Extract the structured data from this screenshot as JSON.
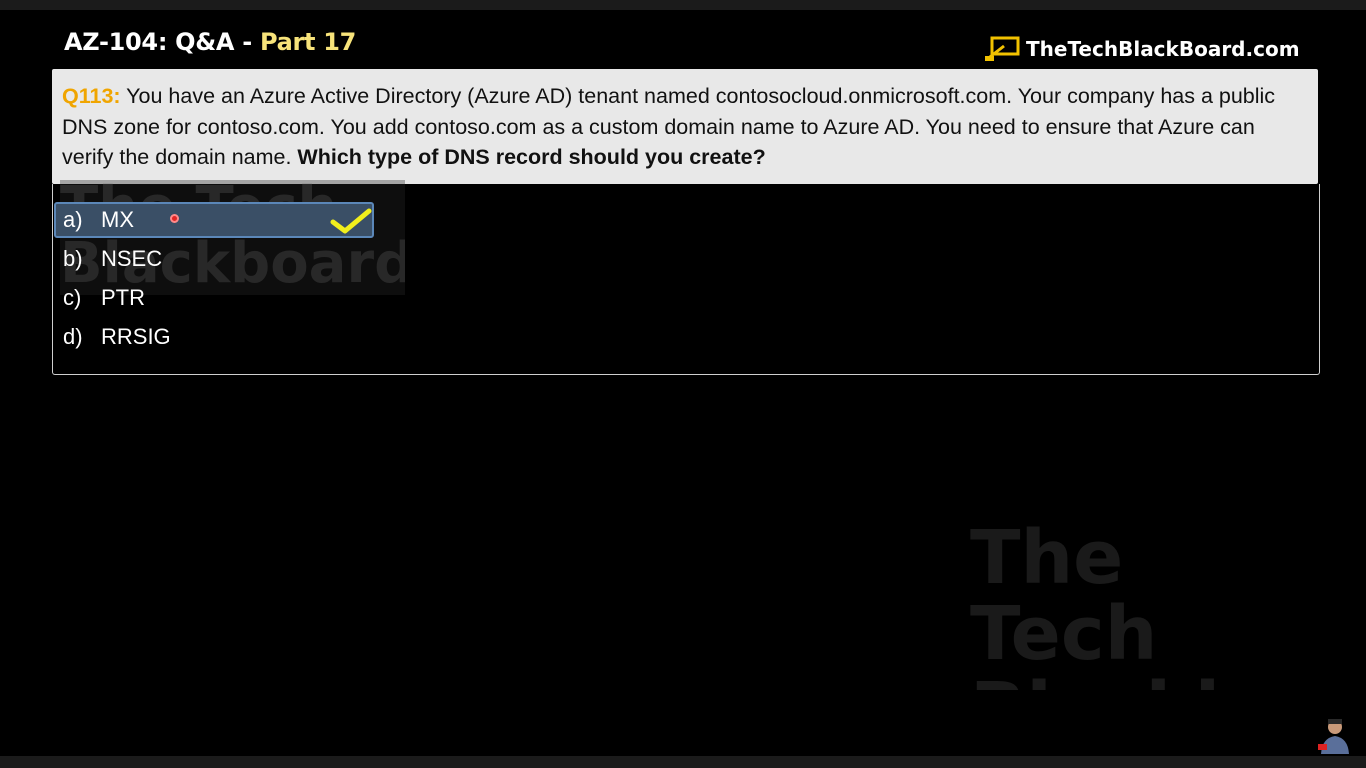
{
  "header": {
    "title_main": "AZ-104: Q&A - ",
    "title_part": "Part 17",
    "brand": "TheTechBlackBoard.com"
  },
  "question": {
    "number": "Q113:",
    "body": " You have an Azure Active Directory (Azure AD) tenant named contosocloud.onmicrosoft.com. Your company has a public DNS zone for contoso.com. You add contoso.com as a custom domain name to Azure AD. You need to ensure that Azure can verify the domain name. ",
    "ask": "Which type of DNS record should you create?"
  },
  "options": [
    {
      "letter": "a)",
      "text": "MX",
      "selected": true
    },
    {
      "letter": "b)",
      "text": "NSEC",
      "selected": false
    },
    {
      "letter": "c)",
      "text": "PTR",
      "selected": false
    },
    {
      "letter": "d)",
      "text": "RRSIG",
      "selected": false
    }
  ],
  "watermark": {
    "line1": "The Tech",
    "line2": "Blackboard"
  },
  "colors": {
    "question_number": "#f0a500",
    "title_part": "#f7e37a",
    "check": "#f2ef1c",
    "selected_bg": "#3a4f66"
  },
  "icons": {
    "brand": "blackboard-logo-icon",
    "correct": "checkmark-icon"
  }
}
